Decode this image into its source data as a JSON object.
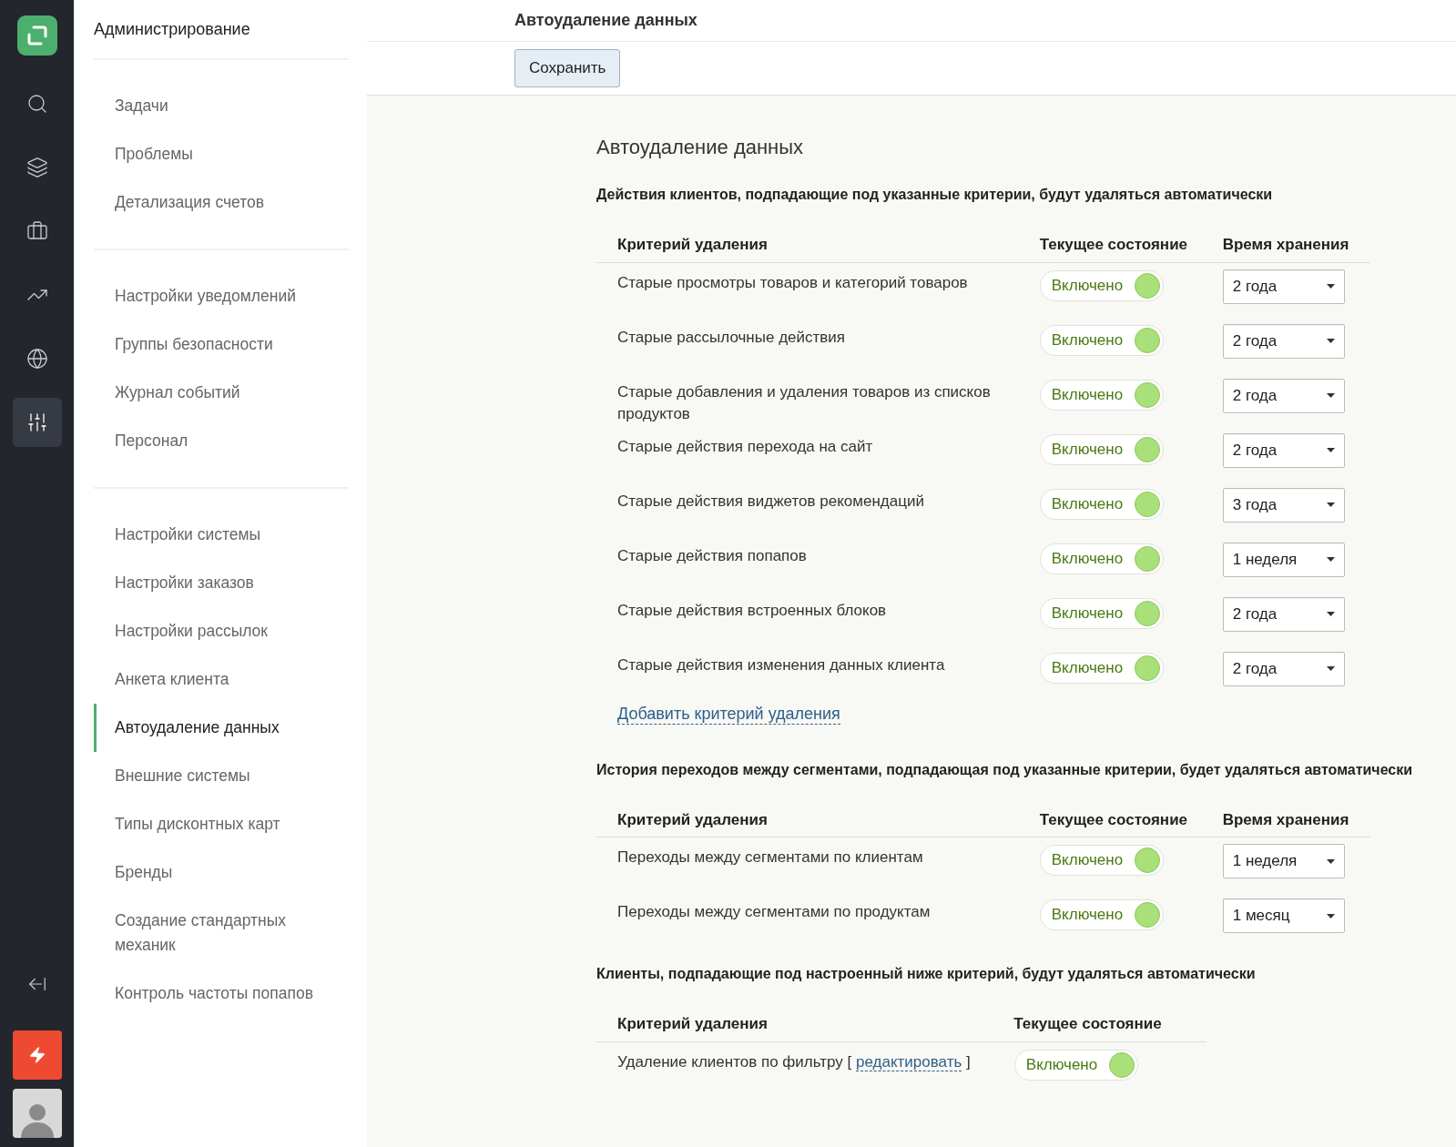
{
  "rail": [
    {
      "kind": "search",
      "selected": false
    },
    {
      "kind": "layers",
      "selected": false
    },
    {
      "kind": "briefcase",
      "selected": false
    },
    {
      "kind": "trend",
      "selected": false
    },
    {
      "kind": "globe",
      "selected": false
    },
    {
      "kind": "sliders",
      "selected": true
    }
  ],
  "sidebar": {
    "title": "Администрирование",
    "groups": [
      [
        {
          "label": "Задачи",
          "selected": false
        },
        {
          "label": "Проблемы",
          "selected": false
        },
        {
          "label": "Детализация счетов",
          "selected": false
        }
      ],
      [
        {
          "label": "Настройки уведомлений",
          "selected": false
        },
        {
          "label": "Группы безопасности",
          "selected": false
        },
        {
          "label": "Журнал событий",
          "selected": false
        },
        {
          "label": "Персонал",
          "selected": false
        }
      ],
      [
        {
          "label": "Настройки системы",
          "selected": false
        },
        {
          "label": "Настройки заказов",
          "selected": false
        },
        {
          "label": "Настройки рассылок",
          "selected": false
        },
        {
          "label": "Анкета клиента",
          "selected": false
        },
        {
          "label": "Автоудаление данных",
          "selected": true
        },
        {
          "label": "Внешние системы",
          "selected": false
        },
        {
          "label": "Типы дисконтных карт",
          "selected": false
        },
        {
          "label": "Бренды",
          "selected": false
        },
        {
          "label": "Создание стандартных механик",
          "selected": false
        },
        {
          "label": "Контроль частоты попапов",
          "selected": false
        }
      ]
    ]
  },
  "header": {
    "title": "Автоудаление данных",
    "save": "Сохранить"
  },
  "page_title": "Автоудаление данных",
  "sections": [
    {
      "heading": "Действия клиентов, подпадающие под указанные критерии, будут удаляться автоматически",
      "columns": [
        "Критерий удаления",
        "Текущее состояние",
        "Время хранения"
      ],
      "rows": [
        {
          "label": "Старые просмотры товаров и категорий товаров",
          "state": "Включено",
          "on": true,
          "retention": "2 года"
        },
        {
          "label": "Старые рассылочные действия",
          "state": "Включено",
          "on": true,
          "retention": "2 года"
        },
        {
          "label": "Старые добавления и удаления товаров из списков продуктов",
          "state": "Включено",
          "on": true,
          "retention": "2 года"
        },
        {
          "label": "Старые действия перехода на сайт",
          "state": "Включено",
          "on": true,
          "retention": "2 года"
        },
        {
          "label": "Старые действия виджетов рекомендаций",
          "state": "Включено",
          "on": true,
          "retention": "3 года"
        },
        {
          "label": "Старые действия попапов",
          "state": "Включено",
          "on": true,
          "retention": "1 неделя"
        },
        {
          "label": "Старые действия встроенных блоков",
          "state": "Включено",
          "on": true,
          "retention": "2 года"
        },
        {
          "label": "Старые действия изменения данных клиента",
          "state": "Включено",
          "on": true,
          "retention": "2 года"
        }
      ],
      "add_link": "Добавить критерий удаления"
    },
    {
      "heading": "История переходов между сегментами, подпадающая под указанные критерии, будет удаляться автоматически",
      "columns": [
        "Критерий удаления",
        "Текущее состояние",
        "Время хранения"
      ],
      "rows": [
        {
          "label": "Переходы между сегментами по клиентам",
          "state": "Включено",
          "on": true,
          "retention": "1 неделя"
        },
        {
          "label": "Переходы между сегментами по продуктам",
          "state": "Включено",
          "on": true,
          "retention": "1 месяц"
        }
      ]
    },
    {
      "heading": "Клиенты, подпадающие под настроенный ниже критерий, будут удаляться автоматически",
      "columns": [
        "Критерий удаления",
        "Текущее состояние"
      ],
      "rows": [
        {
          "label": "Удаление клиентов по фильтру [",
          "link": "редактировать",
          "label_after": "]",
          "state": "Включено",
          "on": true
        }
      ]
    }
  ]
}
